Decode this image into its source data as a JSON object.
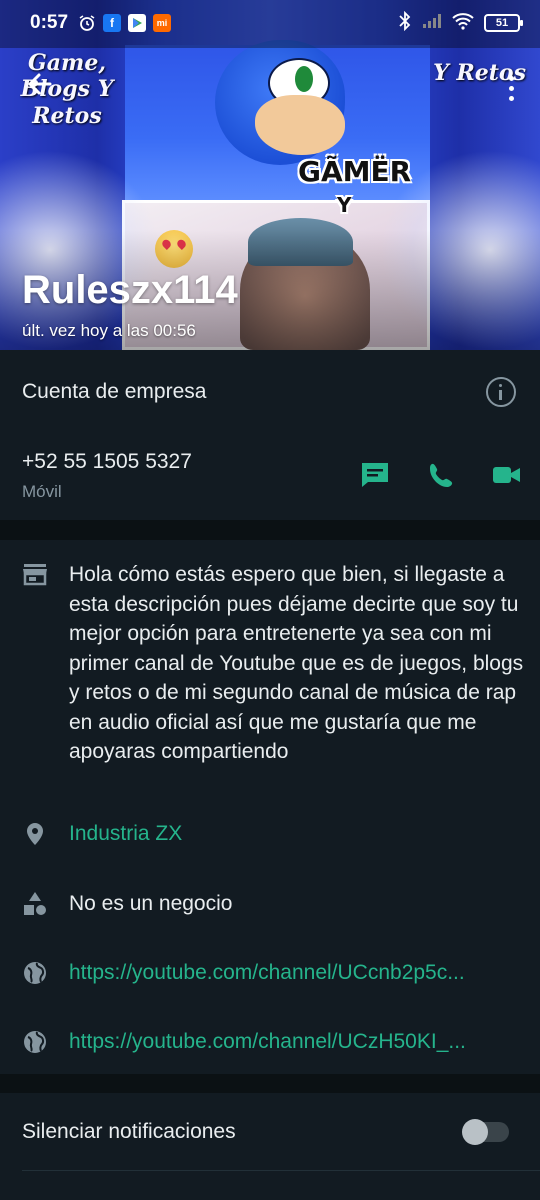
{
  "status_bar": {
    "time": "0:57",
    "battery": "51"
  },
  "header": {
    "contact_name": "Ruleszx114",
    "last_seen": "últ. vez hoy a las 00:56",
    "banner_left_text": "Game, Blogs Y Retos",
    "banner_right_text": "Y Retos",
    "banner_gamer_text": "GÃMËR",
    "banner_y_text": "Y"
  },
  "business": {
    "label": "Cuenta de empresa",
    "phone": "+52 55 1505 5327",
    "phone_type": "Móvil"
  },
  "profile": {
    "description": "Hola cómo estás espero que bien, si llegaste a esta descripción pues déjame decirte que soy tu mejor opción para entretenerte ya sea con mi primer canal de Youtube que es de juegos, blogs y retos o de mi segundo canal de música de rap en audio oficial así que me gustaría que me apoyaras compartiendo",
    "location": "Industria ZX",
    "category": "No es un negocio",
    "link1": "https://youtube.com/channel/UCcnb2p5c...",
    "link2": "https://youtube.com/channel/UCzH50KI_..."
  },
  "settings": {
    "mute_label": "Silenciar notificaciones",
    "mute_enabled": false
  },
  "colors": {
    "accent": "#25b48c",
    "background": "#0b1114",
    "section": "#121b22"
  }
}
